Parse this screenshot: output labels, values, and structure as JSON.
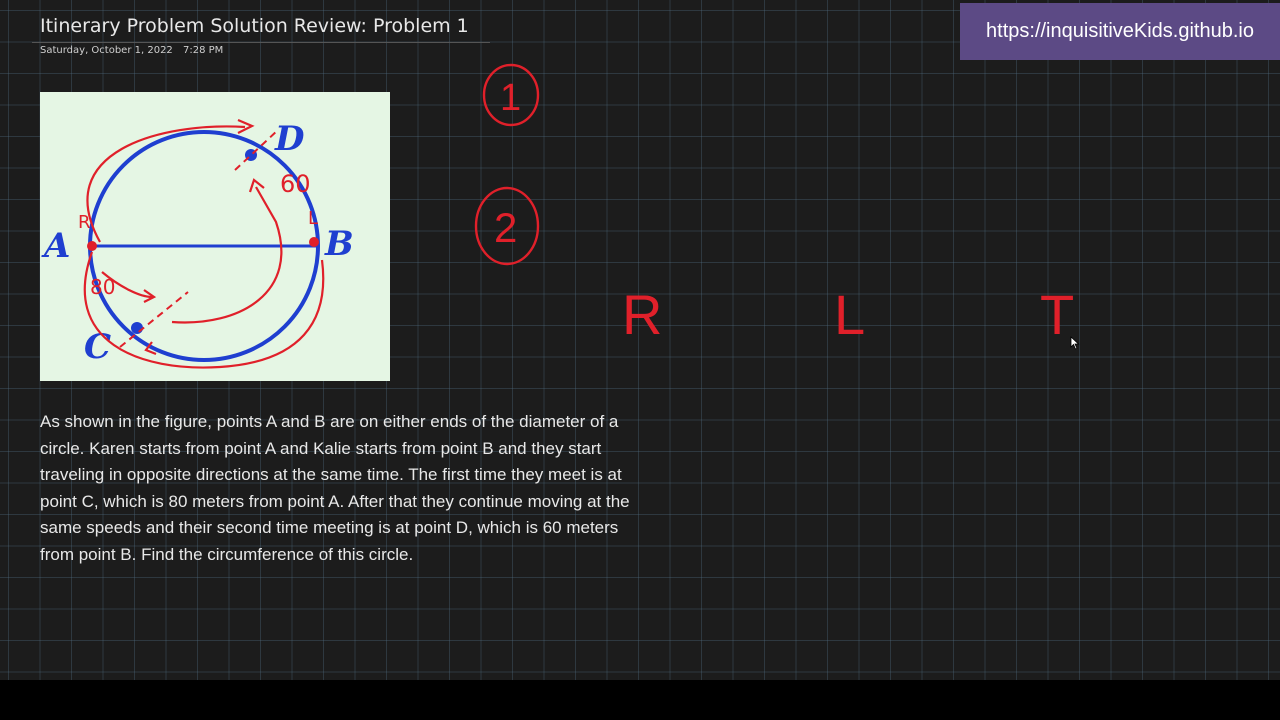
{
  "page": {
    "title": "Itinerary Problem Solution Review: Problem 1",
    "date": "Saturday, October 1, 2022",
    "time": "7:28 PM"
  },
  "banner": {
    "url": "https://inquisitiveKids.github.io"
  },
  "figure": {
    "point_labels": [
      "A",
      "B",
      "C",
      "D"
    ],
    "handwritten_labels": [
      "R",
      "L",
      "80",
      "60"
    ]
  },
  "problem": {
    "text": "As shown in the figure, points A and B are on either ends of the diameter of a circle. Karen starts from point A and Kalie starts from point B and they start traveling in opposite directions at the same time. The first time they meet is at point C, which is 80 meters from point A. After that they continue moving at the same speeds and their second time meeting is at point D, which is 60 meters from point B. Find the circumference of this circle."
  },
  "annotations": {
    "step_numbers": [
      "1",
      "2"
    ],
    "column_labels": [
      "R",
      "L",
      "T"
    ]
  },
  "colors": {
    "ink_red": "#e0202a",
    "circle_blue": "#1f3fd0",
    "banner_purple": "#5c4a85"
  }
}
